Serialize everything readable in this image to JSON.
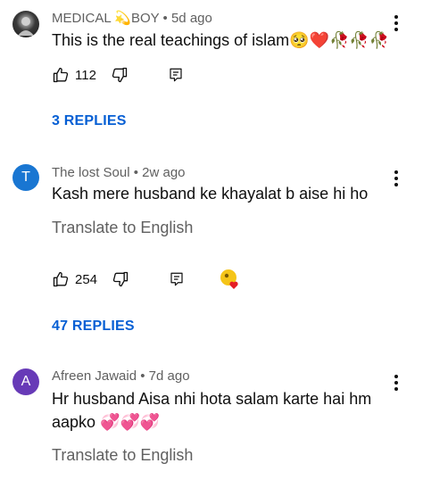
{
  "comments": [
    {
      "author": "MEDICAL 💫BOY",
      "time": "• 5d ago",
      "text": "This is the real teachings of islam🥺❤️🥀🥀🥀",
      "likes": "112",
      "replies": "3 REPLIES"
    },
    {
      "avatar_letter": "T",
      "avatar_color": "#1976d2",
      "author": "The lost Soul",
      "time": "• 2w ago",
      "text": "Kash mere husband ke khayalat b aise hi ho",
      "translate": "Translate to English",
      "likes": "254",
      "replies": "47 REPLIES"
    },
    {
      "avatar_letter": "A",
      "avatar_color": "#673ab7",
      "author": "Afreen Jawaid",
      "time": "• 7d ago",
      "text_line1": "Hr husband Aisa nhi hota salam karte hai hm",
      "text_line2": "aapko 💞💞💞",
      "translate": "Translate to English"
    }
  ],
  "icons": [
    "more-vert-icon",
    "thumb-up-icon",
    "thumb-down-icon",
    "reply-icon",
    "creator-heart-icon"
  ]
}
